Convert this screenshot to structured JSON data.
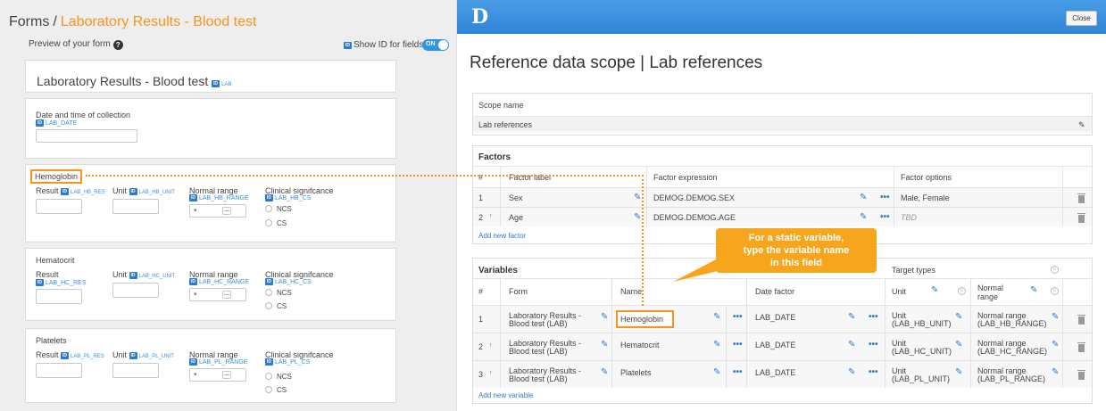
{
  "left": {
    "breadcrumb": {
      "root": "Forms",
      "sep": "/",
      "current": "Laboratory Results - Blood test"
    },
    "preview_label": "Preview of your form",
    "help_icon": "?",
    "show_id_label": "Show ID for fields",
    "toggle_label": "ON",
    "id_badge": "ID",
    "form_title": "Laboratory Results - Blood test",
    "form_id": "LAB",
    "date_section": {
      "label": "Date and time of collection",
      "id": "LAB_DATE"
    },
    "sections": [
      {
        "title": "Hemoglobin",
        "result_label": "Result",
        "result_id": "LAB_HB_RES",
        "unit_label": "Unit",
        "unit_id": "LAB_HB_UNIT",
        "range_label": "Normal range",
        "range_id": "LAB_HB_RANGE",
        "sig_label": "Clinical signifcance",
        "sig_id": "LAB_HB_CS"
      },
      {
        "title": "Hematocrit",
        "result_label": "Result",
        "result_id": "LAB_HC_RES",
        "unit_label": "Unit",
        "unit_id": "LAB_HC_UNIT",
        "range_label": "Normal range",
        "range_id": "LAB_HC_RANGE",
        "sig_label": "Clinical signifcance",
        "sig_id": "LAB_HC_CS"
      },
      {
        "title": "Platelets",
        "result_label": "Result",
        "result_id": "LAB_PL_RES",
        "unit_label": "Unit",
        "unit_id": "LAB_PL_UNIT",
        "range_label": "Normal range",
        "range_id": "LAB_PL_RANGE",
        "sig_label": "Clinical signifcance",
        "sig_id": "LAB_PL_CS"
      }
    ],
    "radio_options": [
      "NCS",
      "CS"
    ],
    "select_arrow": "▾",
    "minus_sign": "—"
  },
  "right": {
    "logo": "D",
    "close_label": "Close",
    "title": "Reference data scope | Lab references",
    "scope": {
      "label": "Scope name",
      "value": "Lab references"
    },
    "factors": {
      "title": "Factors",
      "headers": [
        "#",
        "Factor label",
        "Factor expression",
        "Factor options"
      ],
      "rows": [
        {
          "num": "1",
          "label": "Sex",
          "expr": "DEMOG.DEMOG.SEX",
          "options": "Male, Female"
        },
        {
          "num": "2",
          "label": "Age",
          "expr": "DEMOG.DEMOG.AGE",
          "options": "TBD"
        }
      ],
      "add_link": "Add new factor"
    },
    "variables": {
      "title": "Variables",
      "target_types": "Target types",
      "headers": [
        "#",
        "Form",
        "Name",
        "Date factor",
        "Unit",
        "Normal range"
      ],
      "rows": [
        {
          "num": "1",
          "form_line1": "Laboratory Results -",
          "form_line2": "Blood test (LAB)",
          "name": "Hemoglobin",
          "date": "LAB_DATE",
          "unit_line1": "Unit",
          "unit_line2": "(LAB_HB_UNIT)",
          "range_line1": "Normal range",
          "range_line2": "(LAB_HB_RANGE)"
        },
        {
          "num": "2",
          "form_line1": "Laboratory Results -",
          "form_line2": "Blood test (LAB)",
          "name": "Hematocrit",
          "date": "LAB_DATE",
          "unit_line1": "Unit",
          "unit_line2": "(LAB_HC_UNIT)",
          "range_line1": "Normal range",
          "range_line2": "(LAB_HC_RANGE)"
        },
        {
          "num": "3",
          "form_line1": "Laboratory Results -",
          "form_line2": "Blood test (LAB)",
          "name": "Platelets",
          "date": "LAB_DATE",
          "unit_line1": "Unit",
          "unit_line2": "(LAB_PL_UNIT)",
          "range_line1": "Normal range",
          "range_line2": "(LAB_PL_RANGE)"
        }
      ],
      "add_link": "Add new variable"
    },
    "callout": {
      "line1": "For a static variable,",
      "line2": "type the variable name",
      "line3": "in this field"
    },
    "dots": "•••",
    "arrow_up": "↑",
    "sort_glyph": "○",
    "pencil": "✎"
  },
  "colors": {
    "accent_orange": "#f7941d",
    "link_blue": "#2e7ad1",
    "header_blue": "#3a8ee6"
  }
}
